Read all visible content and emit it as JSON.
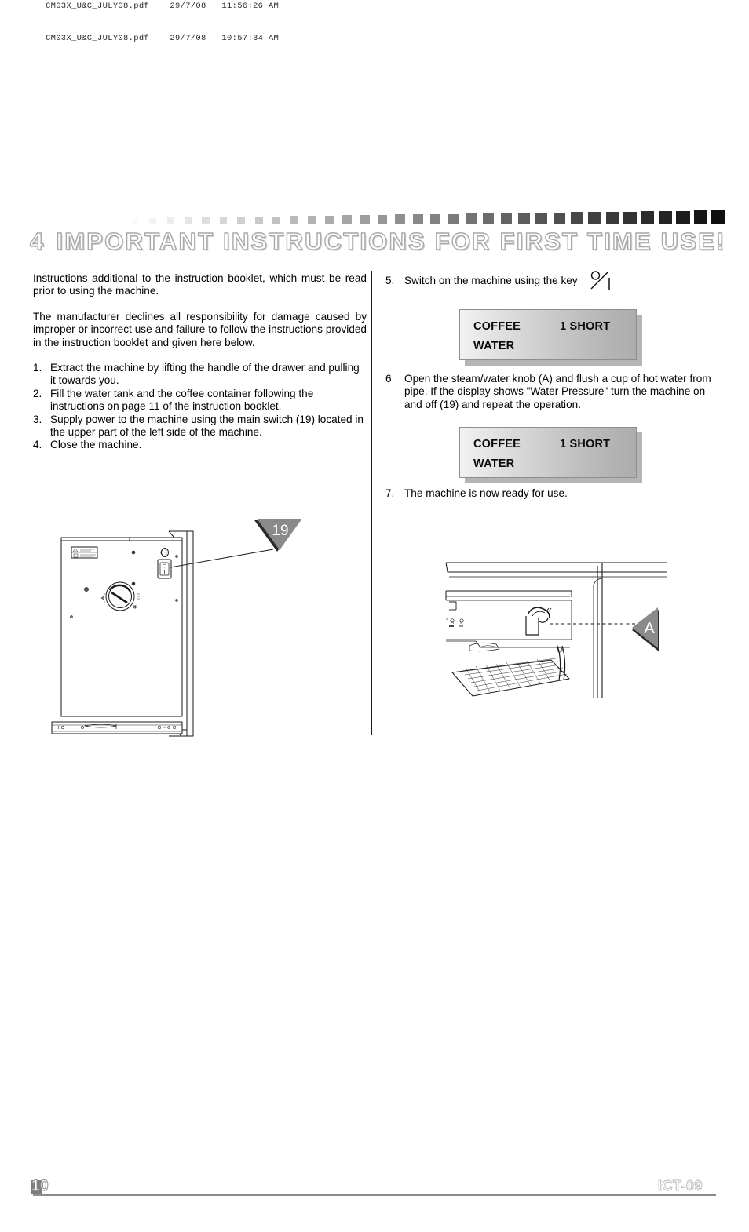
{
  "pdf_stamps": [
    "CM03X_U&C_JULY08.pdf    29/7/08   11:56:26 AM",
    "CM03X_U&C_JULY08.pdf    29/7/08   10:57:34 AM"
  ],
  "section": {
    "number": "4",
    "title": "IMPORTANT INSTRUCTIONS FOR FIRST TIME USE!"
  },
  "left_column": {
    "paragraphs": [
      "Instructions additional to the instruction booklet, which must be read prior to using the machine.",
      "The manufacturer declines all responsibility for damage caused by improper or incorrect use and failure to follow the instructions provided in the instruction booklet and given here below."
    ],
    "steps": [
      {
        "marker": "1.",
        "text": "Extract the machine by lifting the handle of the drawer and pulling it towards you."
      },
      {
        "marker": "2.",
        "text": "Fill the water tank and the coffee container following the instructions on page 11 of the instruction booklet."
      },
      {
        "marker": "3.",
        "text": "Supply power to the machine using the main switch (19) located in the upper part of the left side of the machine."
      },
      {
        "marker": "4.",
        "text": "Close the machine."
      }
    ]
  },
  "right_column": {
    "step5": {
      "marker": "5.",
      "text": "Switch on the machine using the key",
      "icon": "power-key-icon"
    },
    "step6": {
      "marker": "6",
      "text": "Open the steam/water knob (A) and flush a cup of hot water from pipe. If the display shows \"Water Pressure\" turn the machine on and off (19) and repeat the operation."
    },
    "step7": {
      "marker": "7.",
      "text": "The machine is now ready for use."
    }
  },
  "displays": [
    {
      "line1_left": "COFFEE",
      "line1_right": "1 SHORT",
      "line2_left": "WATER"
    },
    {
      "line1_left": "COFFEE",
      "line1_right": "1 SHORT",
      "line2_left": "WATER"
    }
  ],
  "callouts": {
    "left": {
      "label": "19",
      "shape": "triangle-down"
    },
    "right": {
      "label": "A",
      "shape": "triangle-left"
    }
  },
  "footer": {
    "page_number": "10",
    "doc_code": "ICT-09"
  },
  "colors": {
    "callout_fill": "#8a8a8a",
    "callout_text": "#ffffff",
    "lcd_light": "#f2f2f2",
    "lcd_dark": "#adadad",
    "rule": "#8c8c8c",
    "line_art": "#1a1a1a"
  }
}
